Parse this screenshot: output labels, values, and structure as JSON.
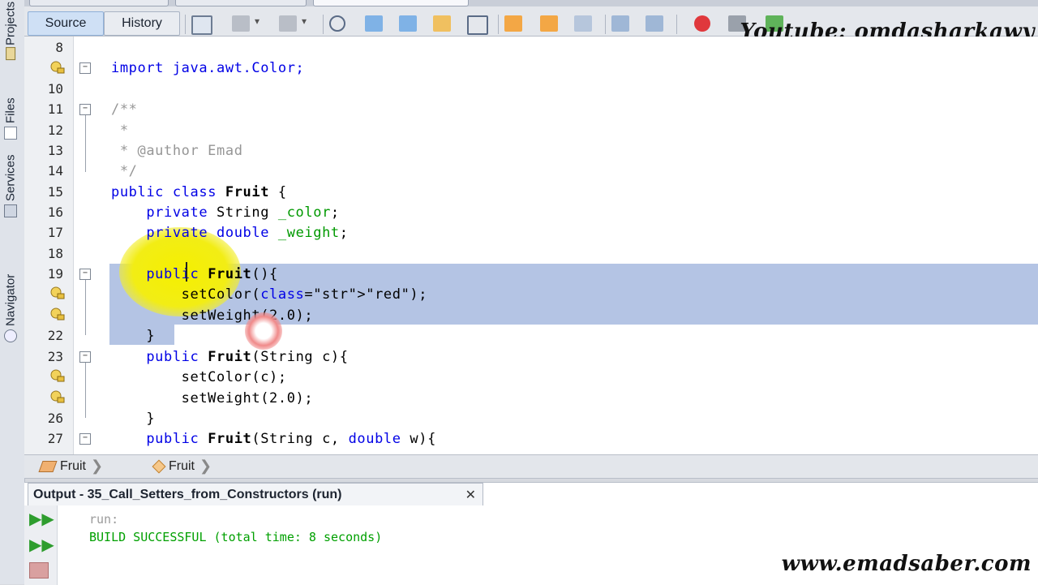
{
  "sidebar": {
    "tabs": [
      {
        "label": "Projects",
        "icon": "projects-icon"
      },
      {
        "label": "Files",
        "icon": "files-icon"
      },
      {
        "label": "Services",
        "icon": "services-icon"
      },
      {
        "label": "Navigator",
        "icon": "navigator-icon"
      }
    ]
  },
  "toolbar": {
    "source_label": "Source",
    "history_label": "History"
  },
  "watermarks": {
    "youtube": "Youtube: omdasharkawy",
    "site": "www.emadsaber.com"
  },
  "editor": {
    "lines": [
      {
        "num": "8",
        "text": ""
      },
      {
        "num": "",
        "text": "import java.awt.Color;"
      },
      {
        "num": "10",
        "text": ""
      },
      {
        "num": "11",
        "text": "/**"
      },
      {
        "num": "12",
        "text": " *"
      },
      {
        "num": "13",
        "text": " * @author Emad"
      },
      {
        "num": "14",
        "text": " */"
      },
      {
        "num": "15",
        "text": "public class Fruit {"
      },
      {
        "num": "16",
        "text": "    private String _color;"
      },
      {
        "num": "17",
        "text": "    private double _weight;"
      },
      {
        "num": "18",
        "text": ""
      },
      {
        "num": "19",
        "text": "    public Fruit(){"
      },
      {
        "num": "",
        "text": "        setColor(\"red\");"
      },
      {
        "num": "",
        "text": "        setWeight(2.0);"
      },
      {
        "num": "22",
        "text": "    }"
      },
      {
        "num": "23",
        "text": "    public Fruit(String c){"
      },
      {
        "num": "",
        "text": "        setColor(c);"
      },
      {
        "num": "",
        "text": "        setWeight(2.0);"
      },
      {
        "num": "26",
        "text": "    }"
      },
      {
        "num": "27",
        "text": "    public Fruit(String c, double w){"
      }
    ]
  },
  "breadcrumbs": {
    "items": [
      "Fruit",
      "Fruit"
    ]
  },
  "output": {
    "tab_title": "Output - 35_Call_Setters_from_Constructors (run)",
    "close_label": "✕",
    "lines": [
      "run:",
      "BUILD SUCCESSFUL (total time: 8 seconds)"
    ]
  },
  "colors": {
    "keyword": "#0000e6",
    "comment": "#969696",
    "string": "#ce7b00",
    "field": "#009900",
    "selection": "#b4c4e4",
    "build_success": "#00a000"
  }
}
